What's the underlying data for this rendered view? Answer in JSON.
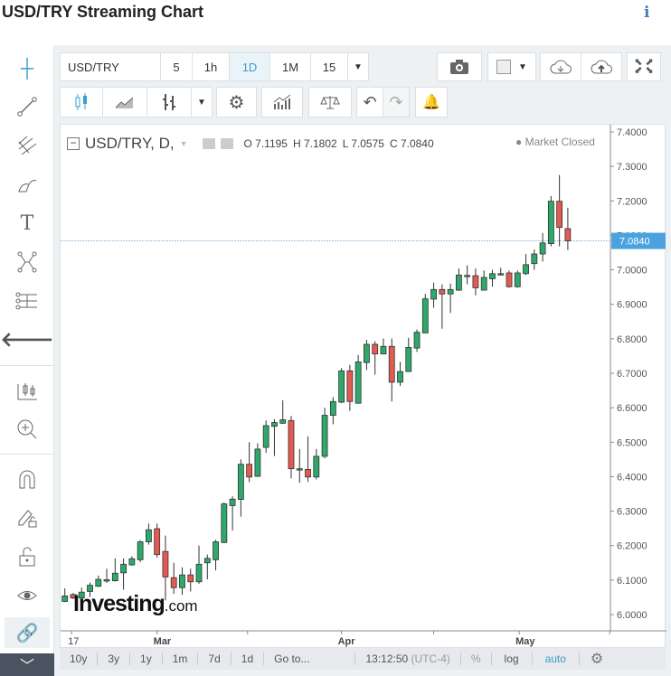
{
  "header": {
    "title": "USD/TRY Streaming Chart",
    "info_icon": "i"
  },
  "toolbar1": {
    "symbol": "USD/TRY",
    "intervals": [
      "5",
      "1h",
      "1D",
      "1M",
      "15"
    ],
    "active_interval": "1D"
  },
  "legend": {
    "symbol": "USD/TRY, D,",
    "open": "O 7.1195",
    "high": "H 7.1802",
    "low": "L 7.0575",
    "close": "C 7.0840",
    "status": "Market Closed"
  },
  "watermark": {
    "brand": "Investing",
    ".com": ".com"
  },
  "bottom": {
    "ranges": [
      "10y",
      "3y",
      "1y",
      "1m",
      "7d",
      "1d"
    ],
    "goto": "Go to...",
    "time": "13:12:50",
    "tz": "(UTC-4)",
    "percent": "%",
    "log": "log",
    "auto": "auto"
  },
  "colors": {
    "up": "#2ea86b",
    "down": "#e25a52",
    "accent": "#3a9fd0",
    "price_label": "#4aa3df"
  },
  "chart_data": {
    "type": "candlestick",
    "symbol": "USD/TRY",
    "ylim": [
      6.0,
      7.4
    ],
    "yticks": [
      "7.4000",
      "7.3000",
      "7.2000",
      "7.1000",
      "7.0000",
      "6.9000",
      "6.8000",
      "6.7000",
      "6.6000",
      "6.5000",
      "6.4000",
      "6.3000",
      "6.2000",
      "6.1000",
      "6.0000"
    ],
    "xlabels": [
      {
        "label": "17",
        "i": 0.8
      },
      {
        "label": "Mar",
        "i": 11
      },
      {
        "label": "Apr",
        "i": 33
      },
      {
        "label": "May",
        "i": 54.2
      }
    ],
    "last_price": "7.0840",
    "last_value": 7.084,
    "ohlc": [
      [
        6.038,
        6.076,
        6.036,
        6.054
      ],
      [
        6.058,
        6.063,
        6.045,
        6.048
      ],
      [
        6.048,
        6.078,
        6.046,
        6.065
      ],
      [
        6.067,
        6.093,
        6.051,
        6.085
      ],
      [
        6.082,
        6.113,
        6.08,
        6.102
      ],
      [
        6.1,
        6.133,
        6.092,
        6.101
      ],
      [
        6.098,
        6.163,
        6.096,
        6.12
      ],
      [
        6.121,
        6.163,
        6.072,
        6.146
      ],
      [
        6.144,
        6.169,
        6.142,
        6.162
      ],
      [
        6.159,
        6.216,
        6.152,
        6.211
      ],
      [
        6.211,
        6.264,
        6.203,
        6.246
      ],
      [
        6.249,
        6.264,
        6.165,
        6.174
      ],
      [
        6.183,
        6.229,
        6.041,
        6.109
      ],
      [
        6.107,
        6.15,
        6.06,
        6.078
      ],
      [
        6.078,
        6.137,
        6.057,
        6.115
      ],
      [
        6.115,
        6.133,
        6.067,
        6.095
      ],
      [
        6.095,
        6.2,
        6.089,
        6.146
      ],
      [
        6.15,
        6.174,
        6.102,
        6.163
      ],
      [
        6.159,
        6.217,
        6.128,
        6.211
      ],
      [
        6.209,
        6.325,
        6.207,
        6.321
      ],
      [
        6.316,
        6.343,
        6.244,
        6.335
      ],
      [
        6.334,
        6.45,
        6.284,
        6.436
      ],
      [
        6.436,
        6.5,
        6.384,
        6.399
      ],
      [
        6.401,
        6.497,
        6.399,
        6.48
      ],
      [
        6.485,
        6.563,
        6.469,
        6.548
      ],
      [
        6.546,
        6.567,
        6.46,
        6.557
      ],
      [
        6.555,
        6.622,
        6.553,
        6.565
      ],
      [
        6.563,
        6.576,
        6.395,
        6.423
      ],
      [
        6.422,
        6.48,
        6.382,
        6.423
      ],
      [
        6.421,
        6.517,
        6.385,
        6.399
      ],
      [
        6.399,
        6.48,
        6.392,
        6.459
      ],
      [
        6.459,
        6.6,
        6.453,
        6.578
      ],
      [
        6.578,
        6.631,
        6.552,
        6.618
      ],
      [
        6.616,
        6.715,
        6.613,
        6.707
      ],
      [
        6.707,
        6.724,
        6.591,
        6.618
      ],
      [
        6.613,
        6.753,
        6.613,
        6.733
      ],
      [
        6.731,
        6.797,
        6.709,
        6.784
      ],
      [
        6.784,
        6.793,
        6.696,
        6.756
      ],
      [
        6.756,
        6.801,
        6.756,
        6.778
      ],
      [
        6.778,
        6.801,
        6.618,
        6.674
      ],
      [
        6.674,
        6.733,
        6.663,
        6.705
      ],
      [
        6.705,
        6.803,
        6.705,
        6.775
      ],
      [
        6.773,
        6.827,
        6.762,
        6.819
      ],
      [
        6.817,
        6.93,
        6.817,
        6.916
      ],
      [
        6.915,
        6.963,
        6.89,
        6.943
      ],
      [
        6.943,
        6.958,
        6.829,
        6.93
      ],
      [
        6.93,
        6.96,
        6.875,
        6.943
      ],
      [
        6.941,
        7.004,
        6.939,
        6.985
      ],
      [
        6.983,
        7.013,
        6.958,
        6.984
      ],
      [
        6.983,
        7.004,
        6.926,
        6.948
      ],
      [
        6.941,
        6.998,
        6.941,
        6.978
      ],
      [
        6.974,
        7.0,
        6.951,
        6.989
      ],
      [
        6.989,
        7.006,
        6.983,
        6.989
      ],
      [
        6.991,
        6.998,
        6.948,
        6.951
      ],
      [
        6.951,
        6.998,
        6.948,
        6.991
      ],
      [
        6.989,
        7.046,
        6.985,
        7.015
      ],
      [
        7.018,
        7.059,
        7.0,
        7.046
      ],
      [
        7.046,
        7.107,
        7.024,
        7.078
      ],
      [
        7.076,
        7.214,
        7.068,
        7.199
      ],
      [
        7.199,
        7.275,
        7.068,
        7.123
      ],
      [
        7.1195,
        7.1802,
        7.0575,
        7.084
      ]
    ]
  }
}
